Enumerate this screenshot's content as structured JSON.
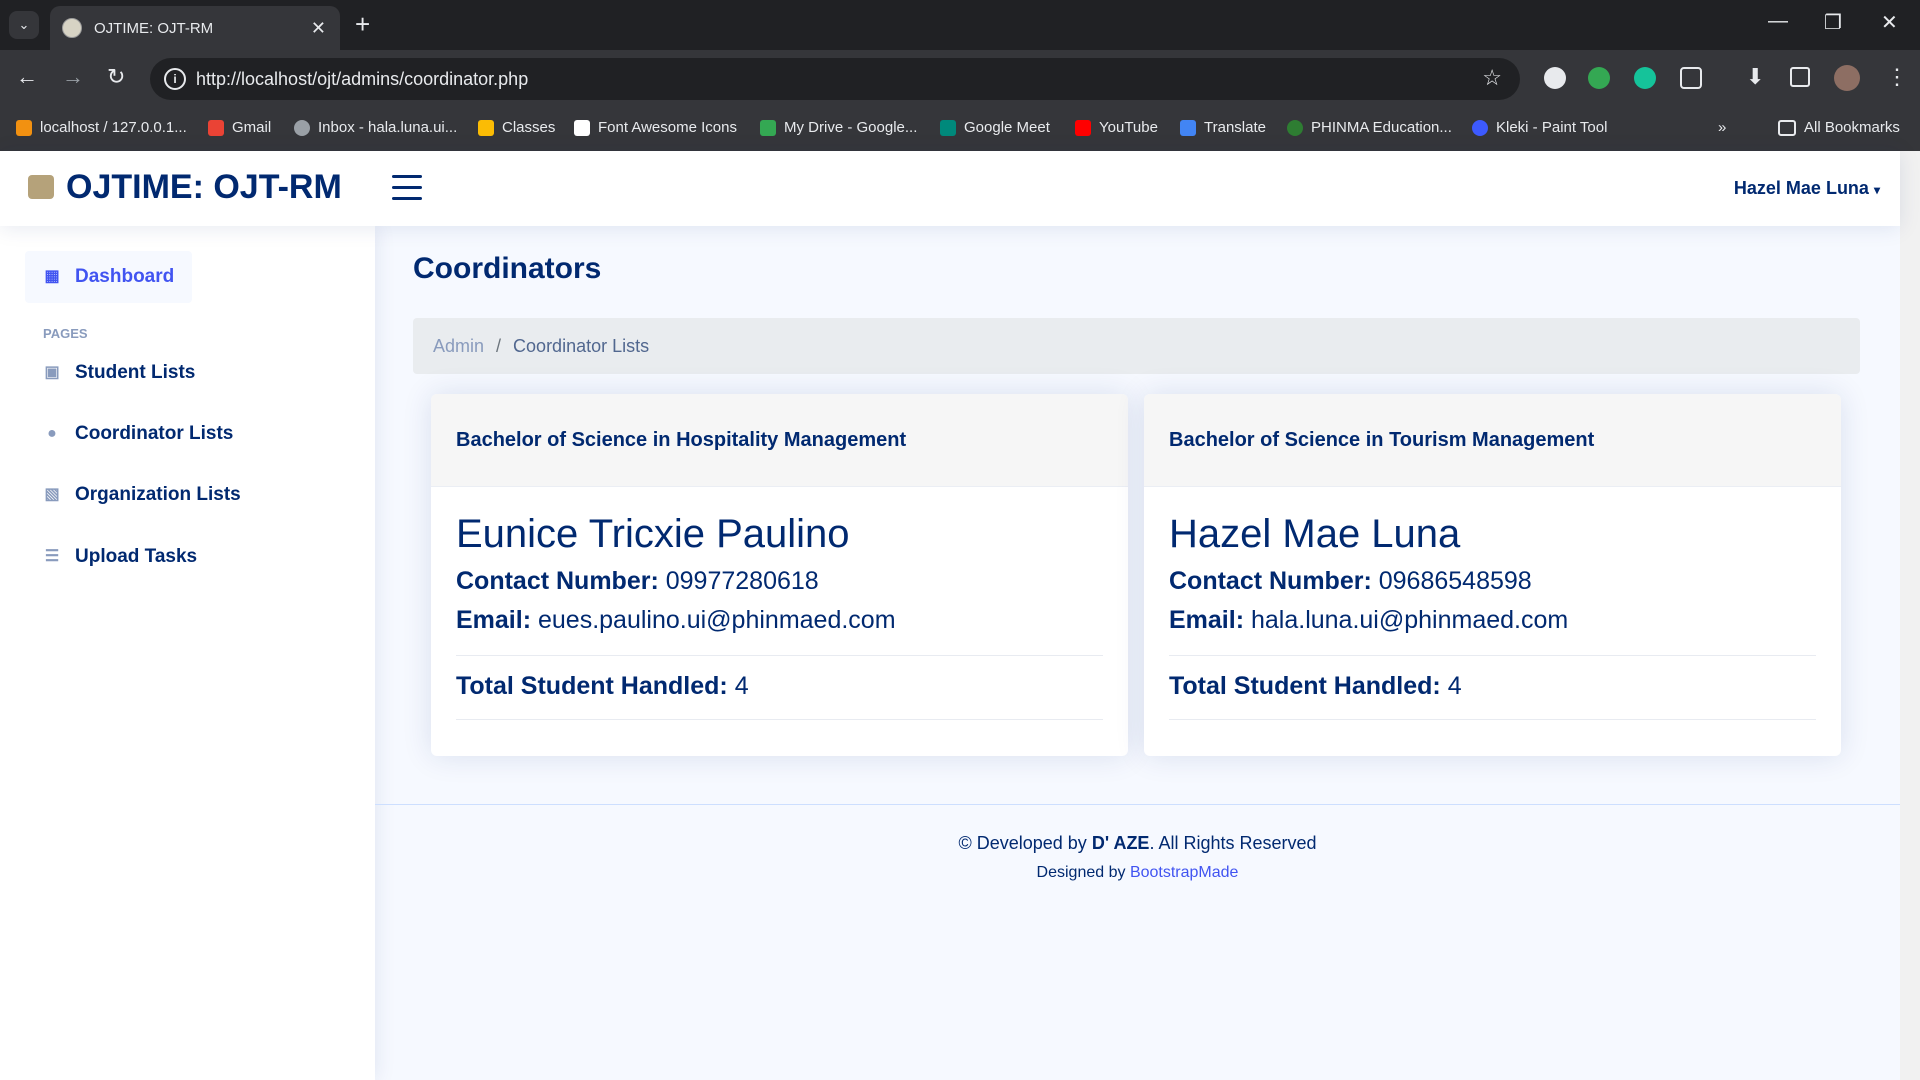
{
  "browser": {
    "tab_title": "OJTIME: OJT-RM",
    "url": "http://localhost/ojt/admins/coordinator.php",
    "bookmarks": [
      {
        "label": "localhost / 127.0.0.1...",
        "color": "#f29111"
      },
      {
        "label": "Gmail",
        "color": "#ea4335"
      },
      {
        "label": "Inbox - hala.luna.ui...",
        "color": "#9aa0a6"
      },
      {
        "label": "Classes",
        "color": "#fbbc04"
      },
      {
        "label": "Font Awesome Icons",
        "color": "#ffffff"
      },
      {
        "label": "My Drive - Google...",
        "color": "#34a853"
      },
      {
        "label": "Google Meet",
        "color": "#00897b"
      },
      {
        "label": "YouTube",
        "color": "#ff0000"
      },
      {
        "label": "Translate",
        "color": "#4285f4"
      },
      {
        "label": "PHINMA Education...",
        "color": "#2e7d32"
      },
      {
        "label": "Kleki - Paint Tool",
        "color": "#3d5afe"
      }
    ],
    "all_bookmarks": "All Bookmarks"
  },
  "header": {
    "logo": "OJTIME: OJT-RM",
    "user": "Hazel Mae Luna"
  },
  "sidebar": {
    "dashboard": "Dashboard",
    "heading": "PAGES",
    "items": [
      {
        "label": "Student Lists",
        "icon": "person-badge-icon"
      },
      {
        "label": "Coordinator Lists",
        "icon": "person-icon"
      },
      {
        "label": "Organization Lists",
        "icon": "building-icon"
      },
      {
        "label": "Upload Tasks",
        "icon": "list-icon"
      }
    ]
  },
  "main": {
    "title": "Coordinators",
    "breadcrumb": {
      "home": "Admin",
      "current": "Coordinator Lists"
    },
    "cards": [
      {
        "program": "Bachelor of Science in Hospitality Management",
        "name": "Eunice Tricxie Paulino",
        "contact_label": "Contact Number:",
        "contact": "09977280618",
        "email_label": "Email:",
        "email": "eues.paulino.ui@phinmaed.com",
        "total_label": "Total Student Handled:",
        "total": "4"
      },
      {
        "program": "Bachelor of Science in Tourism Management",
        "name": "Hazel Mae Luna",
        "contact_label": "Contact Number:",
        "contact": "09686548598",
        "email_label": "Email:",
        "email": "hala.luna.ui@phinmaed.com",
        "total_label": "Total Student Handled:",
        "total": "4"
      }
    ]
  },
  "footer": {
    "copy_prefix": "© Developed by",
    "copy_brand": "D' AZE",
    "copy_suffix": ". All Rights Reserved",
    "designed_by": "Designed by",
    "designer": "BootstrapMade"
  }
}
